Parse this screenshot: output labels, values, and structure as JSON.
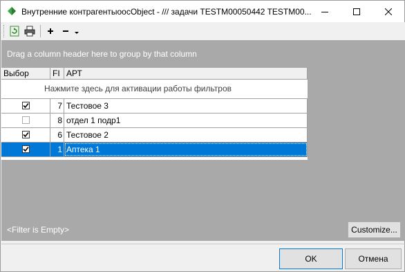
{
  "window": {
    "title": "Внутренние контрагентыоосObject  - ///  задачи TESTM00050442 TESTM00...",
    "minimize_icon": "minimize-icon",
    "maximize_icon": "maximize-icon",
    "close_icon": "close-icon"
  },
  "toolbar": {
    "items": [
      "refresh-icon",
      "print-icon",
      "plus-icon",
      "minus-icon",
      "dropdown-arrow-icon"
    ]
  },
  "group_panel": {
    "text": "Drag a column header here to group by that column"
  },
  "grid": {
    "columns": [
      "Выбор",
      "FI",
      "АРТ"
    ],
    "filter_prompt": "Нажмите здесь для активации работы фильтров",
    "rows": [
      {
        "checked": true,
        "fi": "7",
        "art": "Тестовое 3",
        "selected": false
      },
      {
        "checked": false,
        "fi": "8",
        "art": "отдел 1 подр1",
        "selected": false
      },
      {
        "checked": true,
        "fi": "6",
        "art": "Тестовое 2",
        "selected": false
      },
      {
        "checked": true,
        "fi": "1",
        "art": "Аптека 1",
        "selected": true
      }
    ]
  },
  "status": {
    "filter_text": "<Filter is Empty>",
    "customize_label": "Customize..."
  },
  "buttons": {
    "ok_label": "OK",
    "cancel_label": "Отмена"
  },
  "colors": {
    "selection": "#0078d7",
    "panel_gray": "#a9a9a9"
  }
}
